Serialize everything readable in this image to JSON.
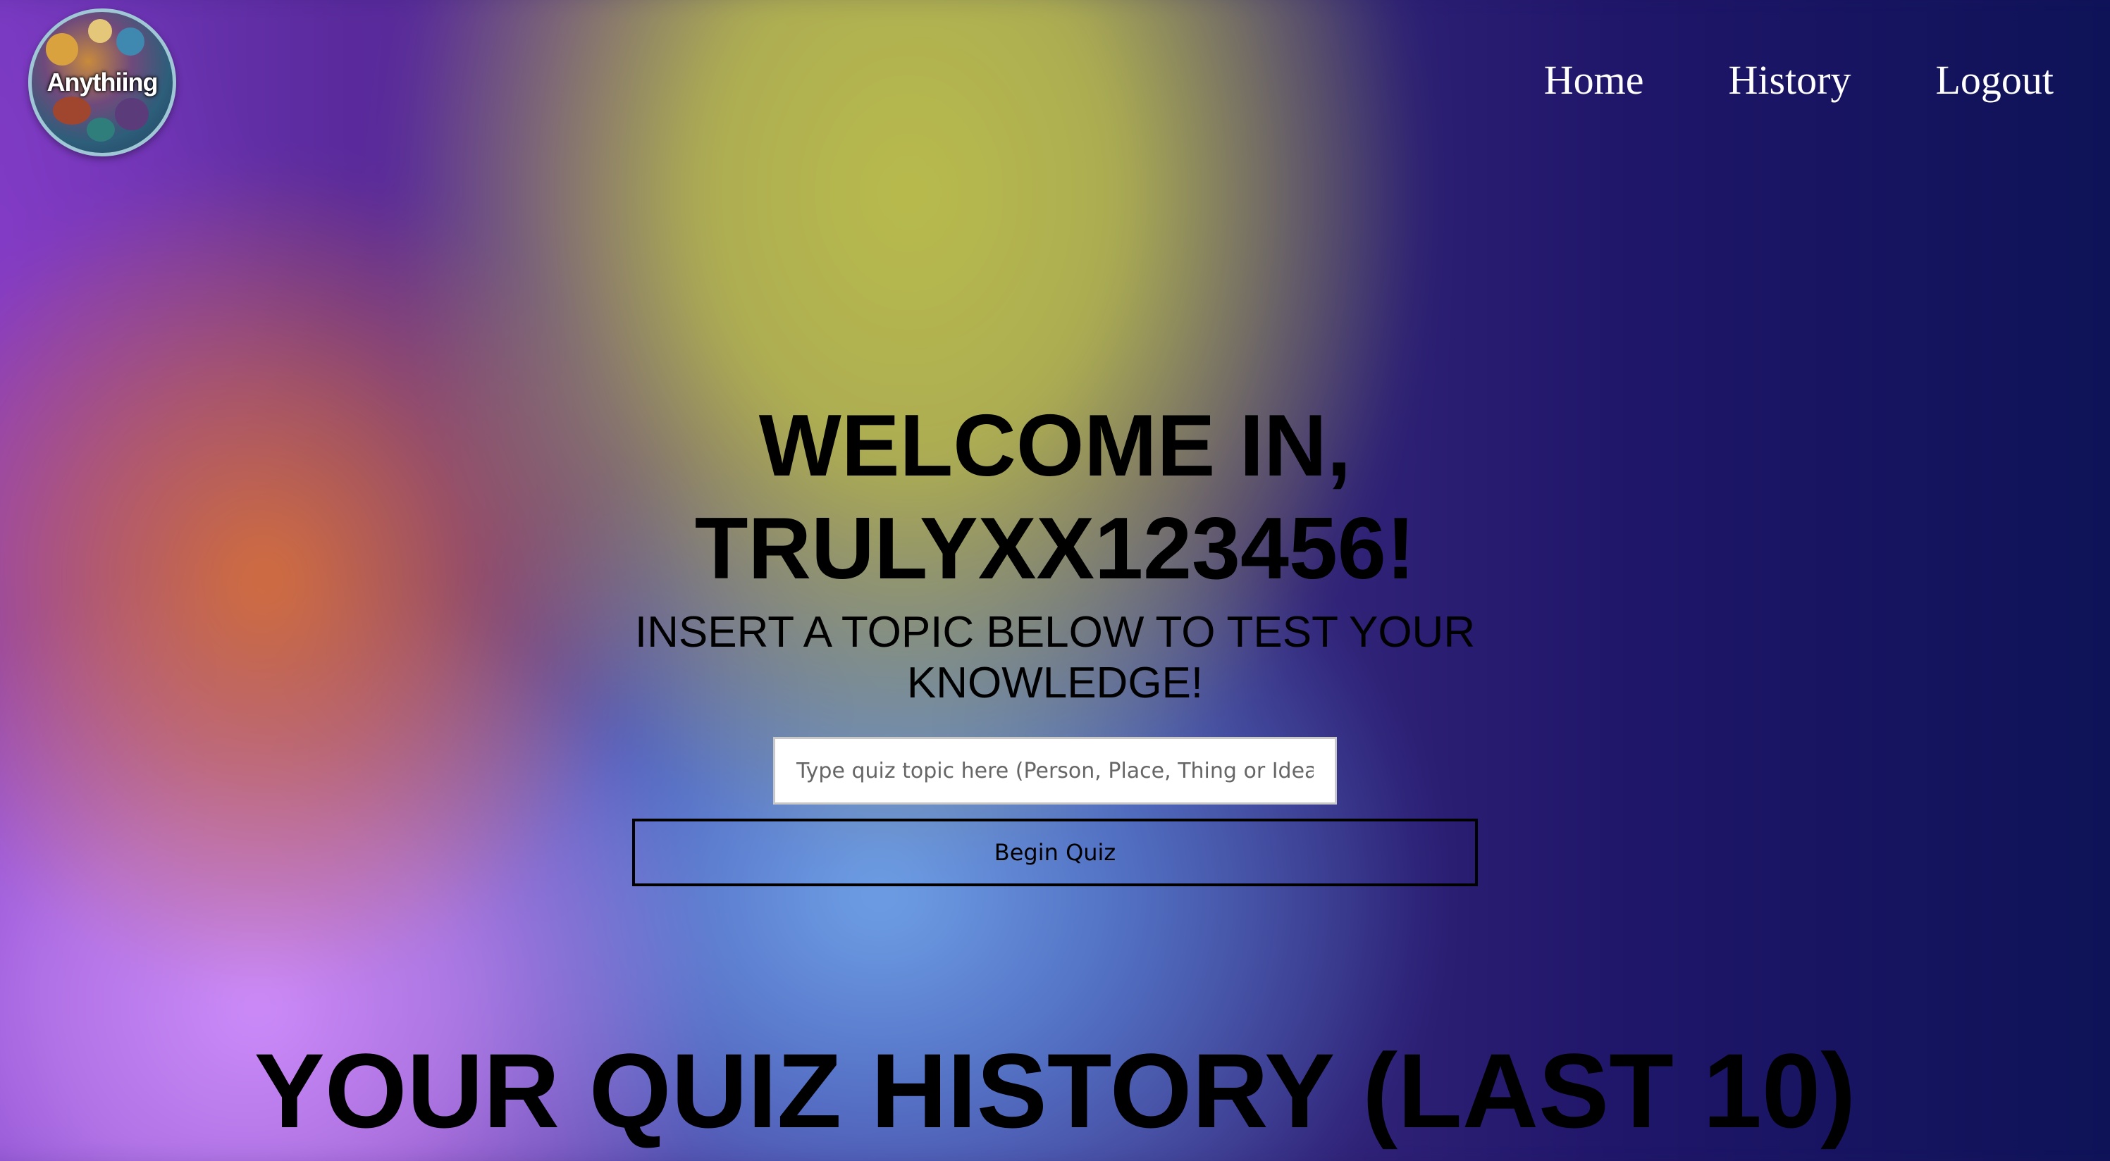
{
  "logo": {
    "text": "Anythiing"
  },
  "nav": {
    "items": [
      {
        "label": "Home"
      },
      {
        "label": "History"
      },
      {
        "label": "Logout"
      }
    ]
  },
  "hero": {
    "welcome_line1": "WELCOME IN,",
    "welcome_line2": "TRULYXX123456!",
    "subtitle": "INSERT A TOPIC BELOW TO TEST YOUR KNOWLEDGE!",
    "topic_placeholder": "Type quiz topic here (Person, Place, Thing or Idea)",
    "topic_value": "",
    "begin_label": "Begin Quiz"
  },
  "history": {
    "title": "YOUR QUIZ HISTORY (LAST 10)"
  }
}
